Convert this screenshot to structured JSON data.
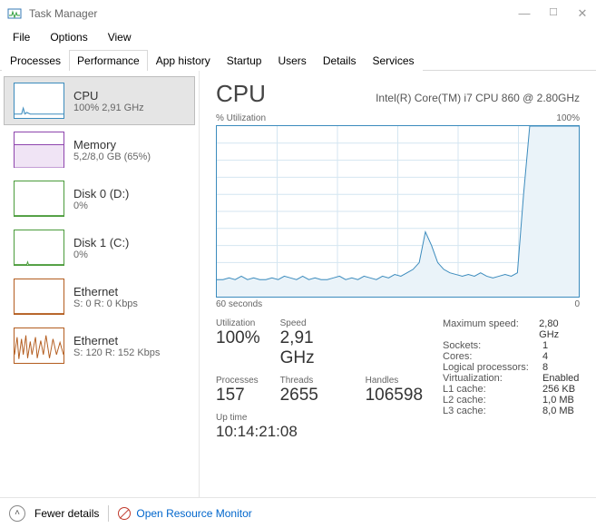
{
  "window": {
    "title": "Task Manager"
  },
  "menu": {
    "file": "File",
    "options": "Options",
    "view": "View"
  },
  "tabs": {
    "processes": "Processes",
    "performance": "Performance",
    "app_history": "App history",
    "startup": "Startup",
    "users": "Users",
    "details": "Details",
    "services": "Services"
  },
  "sidebar": [
    {
      "name": "CPU",
      "sub": "100% 2,91 GHz",
      "color": "#3b8bbd"
    },
    {
      "name": "Memory",
      "sub": "5,2/8,0 GB (65%)",
      "color": "#8e44ad"
    },
    {
      "name": "Disk 0 (D:)",
      "sub": "0%",
      "color": "#4a9b3a"
    },
    {
      "name": "Disk 1 (C:)",
      "sub": "0%",
      "color": "#4a9b3a"
    },
    {
      "name": "Ethernet",
      "sub": "S: 0 R: 0 Kbps",
      "color": "#b35c1e"
    },
    {
      "name": "Ethernet",
      "sub": "S: 120 R: 152 Kbps",
      "color": "#b35c1e"
    }
  ],
  "detail": {
    "title": "CPU",
    "model": "Intel(R) Core(TM) i7 CPU 860 @ 2.80GHz",
    "chart_top_left": "% Utilization",
    "chart_top_right": "100%",
    "chart_bottom_left": "60 seconds",
    "chart_bottom_right": "0"
  },
  "stats": {
    "utilization_label": "Utilization",
    "utilization": "100%",
    "speed_label": "Speed",
    "speed": "2,91 GHz",
    "processes_label": "Processes",
    "processes": "157",
    "threads_label": "Threads",
    "threads": "2655",
    "handles_label": "Handles",
    "handles": "106598",
    "uptime_label": "Up time",
    "uptime": "10:14:21:08"
  },
  "info": [
    {
      "key": "Maximum speed:",
      "val": "2,80 GHz"
    },
    {
      "key": "Sockets:",
      "val": "1"
    },
    {
      "key": "Cores:",
      "val": "4"
    },
    {
      "key": "Logical processors:",
      "val": "8"
    },
    {
      "key": "Virtualization:",
      "val": "Enabled"
    },
    {
      "key": "L1 cache:",
      "val": "256 KB"
    },
    {
      "key": "L2 cache:",
      "val": "1,0 MB"
    },
    {
      "key": "L3 cache:",
      "val": "8,0 MB"
    }
  ],
  "footer": {
    "fewer": "Fewer details",
    "orm": "Open Resource Monitor"
  },
  "chart_data": {
    "type": "line",
    "title": "% Utilization",
    "xlabel": "seconds",
    "xrange": [
      60,
      0
    ],
    "ylabel": "%",
    "ylim": [
      0,
      100
    ],
    "values": [
      10,
      10,
      11,
      10,
      12,
      10,
      11,
      10,
      10,
      11,
      10,
      12,
      11,
      10,
      12,
      10,
      11,
      10,
      10,
      11,
      12,
      10,
      11,
      10,
      12,
      11,
      10,
      12,
      11,
      13,
      12,
      14,
      16,
      20,
      38,
      30,
      20,
      16,
      14,
      13,
      12,
      13,
      12,
      14,
      12,
      11,
      12,
      13,
      12,
      14,
      60,
      100,
      100,
      100,
      100,
      100,
      100,
      100,
      100,
      100
    ]
  }
}
